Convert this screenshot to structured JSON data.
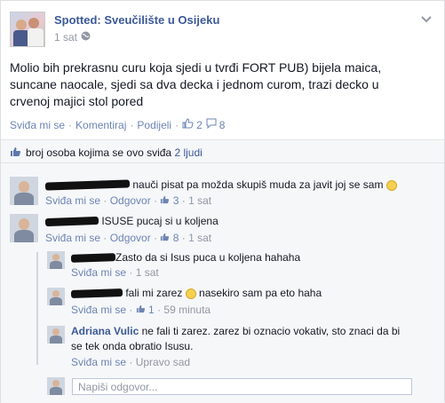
{
  "post": {
    "page_name": "Spotted: Sveučilište u Osijeku",
    "time": "1 sat",
    "text": "Molio bih prekrasnu curu koja sjedi u tvrđi FORT PUB) bijela maica, suncane naocale, sjedi sa dva decka i jednom curom, trazi decko u crvenoj majici stol pored",
    "actions": {
      "like": "Sviđa mi se",
      "comment": "Komentiraj",
      "share": "Podijeli",
      "likes_count": "2",
      "comments_count": "8"
    },
    "likes_summary": {
      "prefix": "broj osoba kojima se ovo sviđa",
      "count": "2 ljudi"
    }
  },
  "comments": [
    {
      "text": "nauči pisat pa možda skupiš muda za javit joj se sam",
      "like": "Sviđa mi se",
      "reply": "Odgovor",
      "likes": "3",
      "time": "1 sat"
    },
    {
      "text": "ISUSE pucaj si u koljena",
      "like": "Sviđa mi se",
      "reply": "Odgovor",
      "likes": "8",
      "time": "1 sat"
    }
  ],
  "replies": [
    {
      "text": "Zasto da si Isus puca u koljena hahaha",
      "like": "Sviđa mi se",
      "time": "1 sat"
    },
    {
      "text": "fali mi zarez",
      "text2": "nasekiro sam pa eto haha",
      "like": "Sviđa mi se",
      "likes": "1",
      "time": "59 minuta"
    },
    {
      "author": "Adriana Vulic",
      "text_line1": "ne fali ti zarez. zarez bi oznacio vokativ, sto znaci da bi",
      "text_line2": "se tek onda obratio Isusu.",
      "like": "Sviđa mi se",
      "time": "Upravo sad"
    }
  ],
  "reply_input": {
    "placeholder": "Napiši odgovor..."
  },
  "colors": {
    "link": "#3b5998",
    "muted": "#9197a3",
    "bg": "#f6f7f9"
  },
  "icons": [
    "globe-icon",
    "chevron-down-icon",
    "thumbs-up-icon",
    "comment-icon",
    "smiley-icon"
  ]
}
